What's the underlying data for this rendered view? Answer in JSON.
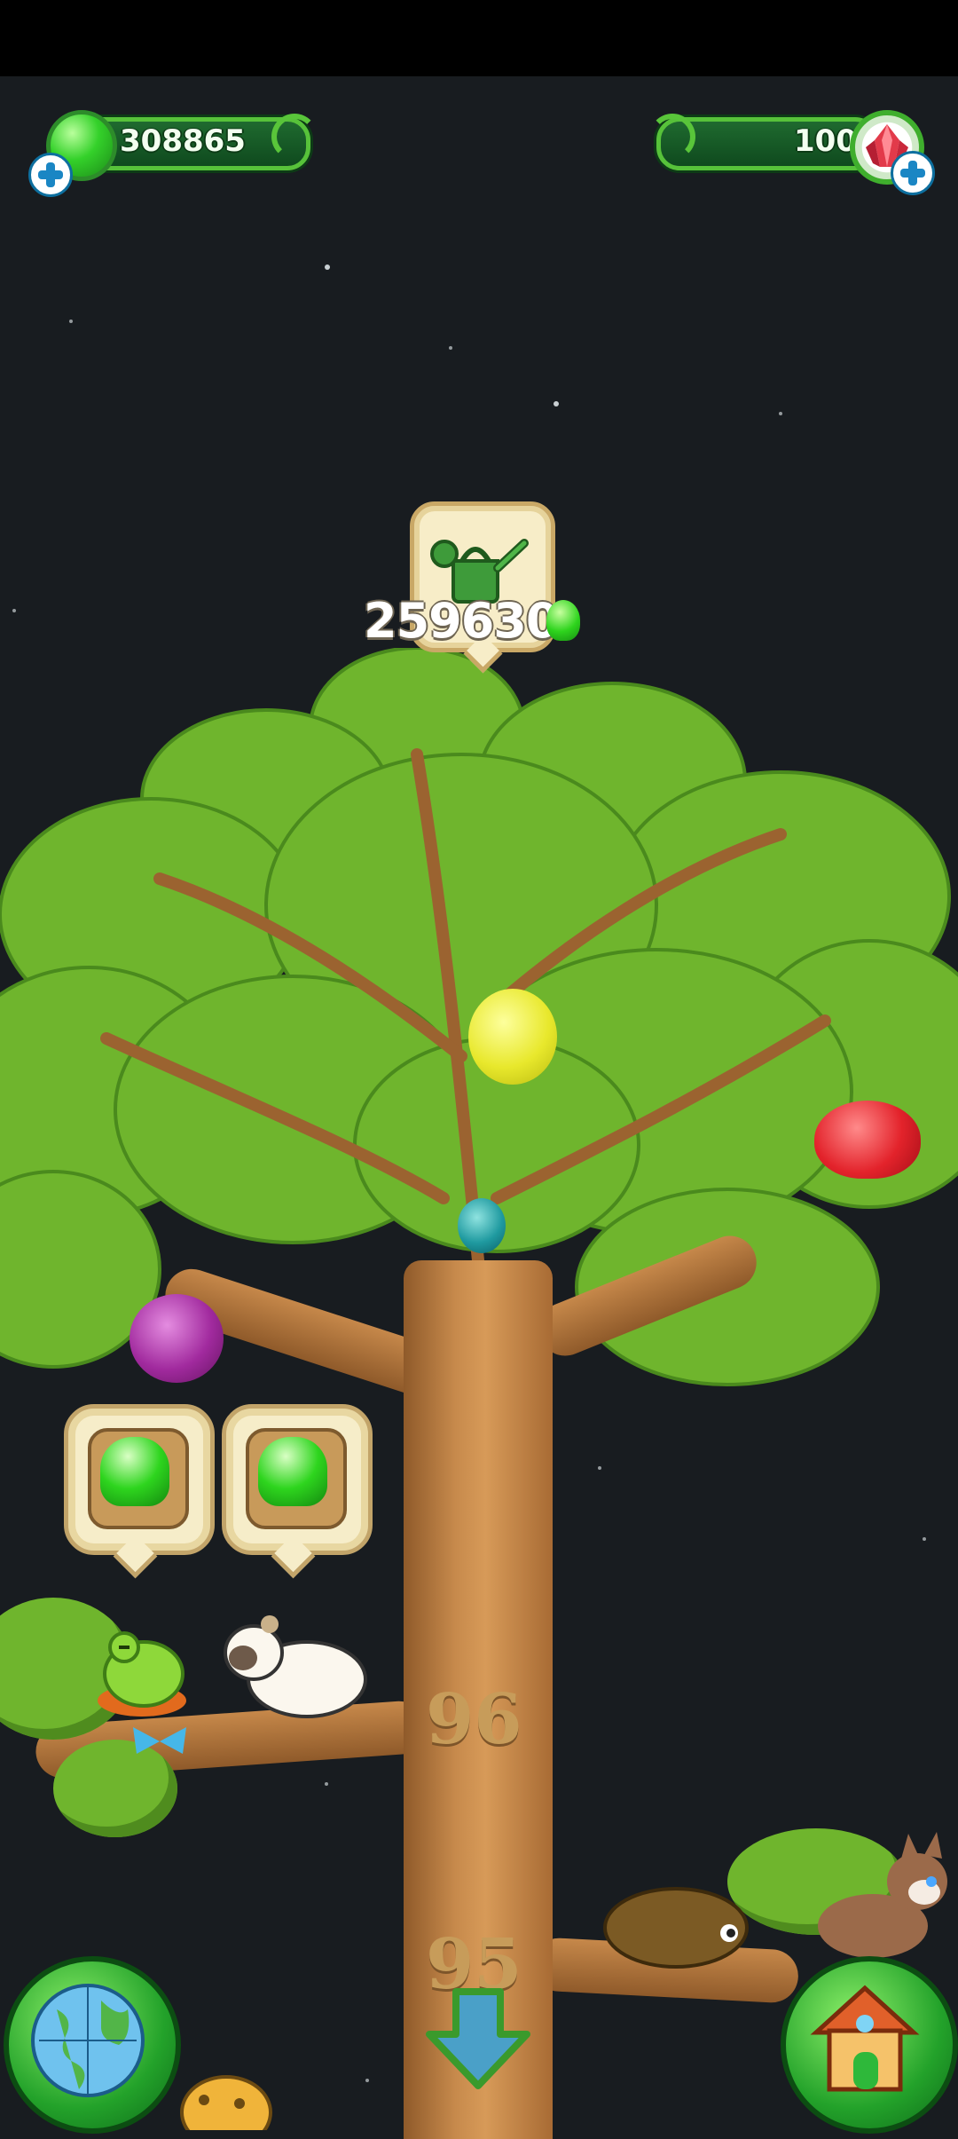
{
  "hud": {
    "gem_count": "308865",
    "ruby_count": "100"
  },
  "watering": {
    "cost": "259630"
  },
  "tree": {
    "levels": [
      "96",
      "95"
    ]
  },
  "icons": {
    "gem": "green-gem-icon",
    "ruby": "red-crystal-icon",
    "add": "plus-icon",
    "water": "watering-can-icon",
    "world": "globe-icon",
    "home": "house-icon",
    "down": "down-arrow-icon"
  },
  "colors": {
    "sky": "#181c20",
    "leaf": "#6fb52d",
    "gem_green": "#2ed41d",
    "bar_border": "#57c23a"
  }
}
